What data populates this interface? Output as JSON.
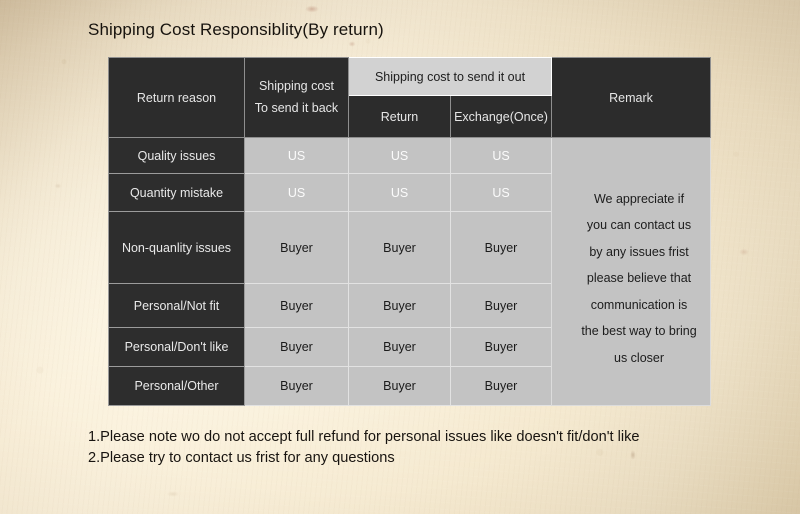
{
  "page": {
    "title": "Shipping Cost Responsiblity(By return)",
    "background_color": "#f0e2c8",
    "dark_cell_color": "#2d2d2d",
    "light_cell_color": "#c3c3c3",
    "span_header_color": "#d2d2d2",
    "text_dark": "#1b1b1b",
    "text_light": "#e9e9e9"
  },
  "table": {
    "headers": {
      "return_reason": "Return reason",
      "shipping_cost_back_line1": "Shipping cost",
      "shipping_cost_back_line2": "To send it back",
      "shipping_cost_out": "Shipping cost to send it out",
      "sub_return": "Return",
      "sub_exchange": "Exchange(Once)",
      "remark": "Remark"
    },
    "rows": [
      {
        "reason": "Quality issues",
        "send_back": "US",
        "return": "US",
        "exchange": "US"
      },
      {
        "reason": "Quantity mistake",
        "send_back": "US",
        "return": "US",
        "exchange": "US"
      },
      {
        "reason": "Non-quanlity issues",
        "send_back": "Buyer",
        "return": "Buyer",
        "exchange": "Buyer"
      },
      {
        "reason": "Personal/Not fit",
        "send_back": "Buyer",
        "return": "Buyer",
        "exchange": "Buyer"
      },
      {
        "reason": "Personal/Don't like",
        "send_back": "Buyer",
        "return": "Buyer",
        "exchange": "Buyer"
      },
      {
        "reason": "Personal/Other",
        "send_back": "Buyer",
        "return": "Buyer",
        "exchange": "Buyer"
      }
    ],
    "remark_lines": [
      "We appreciate if",
      "you can contact us",
      "by any issues frist",
      "please believe that",
      "communication is",
      "the best way to bring",
      "us closer"
    ]
  },
  "notes": [
    "1.Please note wo do not accept full refund for personal issues like doesn't fit/don't like",
    "2.Please try to contact us frist for any questions"
  ]
}
